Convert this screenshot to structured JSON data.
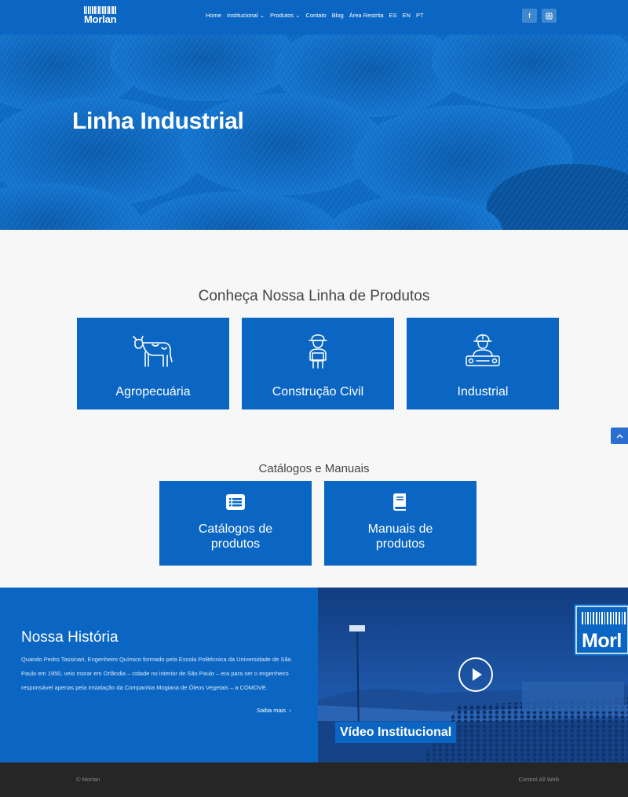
{
  "header": {
    "logo_text": "Morlan",
    "nav": [
      {
        "label": "Home"
      },
      {
        "label": "Institucional",
        "has_dropdown": true
      },
      {
        "label": "Produtos",
        "has_dropdown": true
      },
      {
        "label": "Contato"
      },
      {
        "label": "Blog"
      },
      {
        "label": "Área Restrita"
      },
      {
        "label": "ES"
      },
      {
        "label": "EN"
      },
      {
        "label": "PT"
      }
    ],
    "social": [
      "facebook-icon",
      "instagram-icon"
    ]
  },
  "hero": {
    "title": "Linha Industrial"
  },
  "products": {
    "title": "Conheça Nossa Linha de Produtos",
    "cards": [
      {
        "label": "Agropecuária",
        "icon": "cow-icon"
      },
      {
        "label": "Construção Civil",
        "icon": "construction-worker-icon"
      },
      {
        "label": "Industrial",
        "icon": "industrial-worker-icon"
      }
    ]
  },
  "catalogs": {
    "title": "Catálogos e Manuais",
    "cards": [
      {
        "line1": "Catálogos de",
        "line2": "produtos",
        "icon": "list-icon"
      },
      {
        "line1": "Manuais de",
        "line2": "produtos",
        "icon": "book-icon"
      }
    ]
  },
  "history": {
    "title": "Nossa História",
    "text": "Quando Pedro Tassinari, Engenheiro Químico formado pela Escola Politécnica da Universidade de São Paulo em 1950, veio morar em Orlândia – cidade no interior de São Paulo – era para ser o engenheiro responsável apenas pela instalação da Companhia Mogiana de Óleos Vegetais – a COMOVE.",
    "more": "Saiba mais"
  },
  "video": {
    "label": "Vídeo Institucional",
    "sign_text": "Morl"
  },
  "footer": {
    "left": "© Morlan",
    "right": "Control All Web"
  },
  "colors": {
    "primary": "#0a66c2",
    "footer": "#262626"
  }
}
